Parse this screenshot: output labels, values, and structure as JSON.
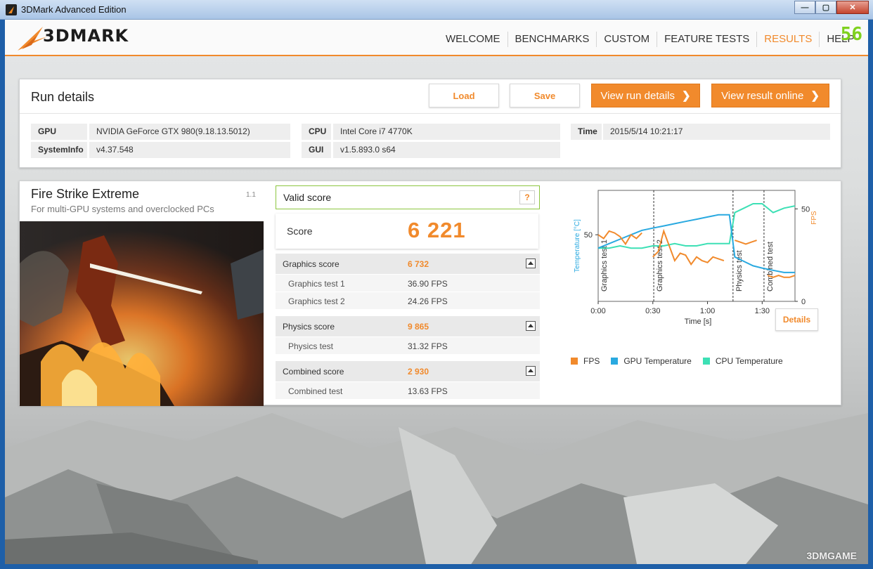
{
  "window": {
    "title": "3DMark Advanced Edition",
    "controls": {
      "minimize": "—",
      "maximize": "▢",
      "close": "✕"
    }
  },
  "header": {
    "logo_text": "3DMARK",
    "nav": [
      "WELCOME",
      "BENCHMARKS",
      "CUSTOM",
      "FEATURE TESTS",
      "RESULTS",
      "HELP"
    ],
    "active_nav": "RESULTS",
    "fps_counter": "56"
  },
  "run_details": {
    "title": "Run details",
    "buttons": {
      "load": "Load",
      "save": "Save",
      "view_run": "View run details",
      "view_online": "View result online"
    },
    "info": {
      "gpu_label": "GPU",
      "gpu_value": "NVIDIA GeForce GTX 980(9.18.13.5012)",
      "sysinfo_label": "SystemInfo",
      "sysinfo_value": "v4.37.548",
      "cpu_label": "CPU",
      "cpu_value": "Intel Core i7 4770K",
      "gui_label": "GUI",
      "gui_value": "v1.5.893.0 s64",
      "time_label": "Time",
      "time_value": "2015/5/14 10:21:17"
    }
  },
  "test": {
    "name": "Fire Strike Extreme",
    "subtitle": "For multi-GPU systems and overclocked PCs",
    "version": "1.1",
    "valid_label": "Valid score",
    "help": "?",
    "score_label": "Score",
    "score_value": "6 221",
    "graphics": {
      "label": "Graphics score",
      "value": "6 732",
      "t1_label": "Graphics test 1",
      "t1_value": "36.90 FPS",
      "t2_label": "Graphics test 2",
      "t2_value": "24.26 FPS"
    },
    "physics": {
      "label": "Physics score",
      "value": "9 865",
      "t_label": "Physics test",
      "t_value": "31.32 FPS"
    },
    "combined": {
      "label": "Combined score",
      "value": "2 930",
      "t_label": "Combined test",
      "t_value": "13.63 FPS"
    }
  },
  "chart_data": {
    "type": "line",
    "xlabel": "Time [s]",
    "ylabel_left": "Temperature [°C]",
    "ylabel_right": "FPS",
    "x_ticks": [
      "0:00",
      "0:30",
      "1:00",
      "1:30"
    ],
    "y_left_ticks": [
      "50"
    ],
    "y_right_ticks": [
      "50",
      "0"
    ],
    "sections": [
      "Graphics test 1",
      "Graphics test 2",
      "Physics test",
      "Combined test"
    ],
    "legend": [
      "FPS",
      "GPU Temperature",
      "CPU Temperature"
    ],
    "colors": {
      "fps": "#f18a2c",
      "gpu": "#29a9e0",
      "cpu": "#3de0b5"
    },
    "details_button": "Details",
    "series": [
      {
        "name": "FPS",
        "x": [
          0,
          3,
          6,
          9,
          12,
          15,
          18,
          21,
          24,
          27,
          30,
          33,
          36,
          39,
          42,
          45,
          48,
          51,
          54,
          57,
          60,
          63,
          66,
          69,
          72,
          75,
          78,
          81,
          84,
          87,
          90,
          93,
          96,
          99,
          102,
          105,
          108
        ],
        "values": [
          36,
          34,
          38,
          37,
          35,
          31,
          36,
          34,
          37,
          null,
          24,
          27,
          38,
          30,
          22,
          26,
          25,
          20,
          24,
          22,
          21,
          24,
          23,
          22,
          null,
          33,
          32,
          31,
          32,
          33,
          null,
          14,
          13,
          14,
          13,
          13,
          14
        ]
      },
      {
        "name": "GPU Temperature",
        "x": [
          0,
          6,
          12,
          18,
          24,
          30,
          36,
          42,
          48,
          54,
          60,
          66,
          72,
          75,
          80,
          85,
          90,
          96,
          102,
          108
        ],
        "values": [
          44,
          46,
          48,
          50,
          52,
          53,
          54,
          55,
          56,
          57,
          58,
          59,
          59,
          40,
          38,
          36,
          35,
          34,
          33,
          33
        ]
      },
      {
        "name": "CPU Temperature",
        "x": [
          0,
          6,
          12,
          18,
          24,
          30,
          36,
          42,
          48,
          54,
          60,
          66,
          72,
          75,
          80,
          85,
          90,
          96,
          102,
          108
        ],
        "values": [
          44,
          44,
          45,
          44,
          44,
          45,
          45,
          46,
          45,
          45,
          46,
          46,
          46,
          60,
          62,
          64,
          64,
          60,
          62,
          63
        ]
      }
    ]
  },
  "watermark": "3DMGAME"
}
